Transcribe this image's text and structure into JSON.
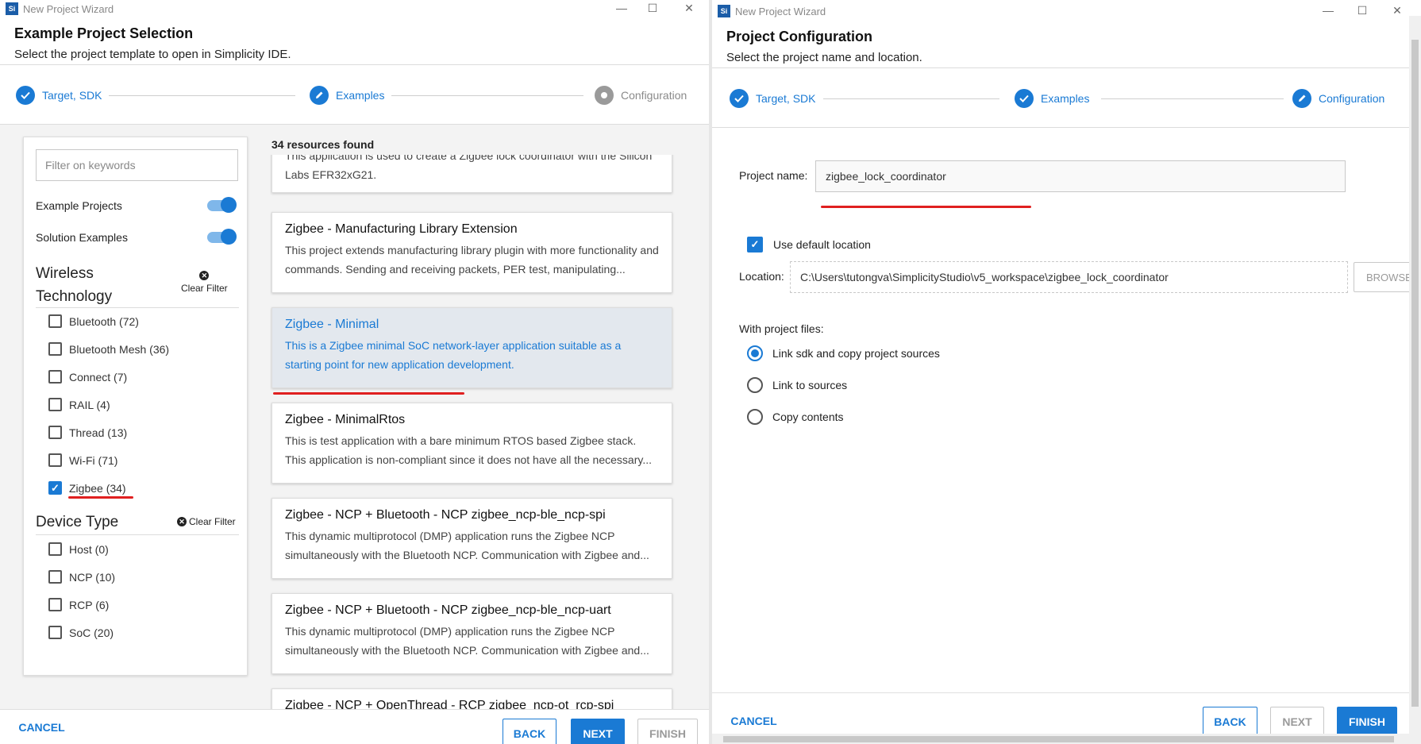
{
  "left_window": {
    "title": "New Project Wizard",
    "header_title": "Example Project Selection",
    "header_subtitle": "Select the project template to open in Simplicity IDE.",
    "steps": [
      {
        "label": "Target, SDK",
        "state": "done"
      },
      {
        "label": "Examples",
        "state": "active"
      },
      {
        "label": "Configuration",
        "state": "pending"
      }
    ],
    "filter": {
      "placeholder": "Filter on keywords",
      "toggles": [
        {
          "label": "Example Projects",
          "on": true
        },
        {
          "label": "Solution Examples",
          "on": true
        }
      ],
      "wireless_title_line1": "Wireless",
      "wireless_title_line2": "Technology",
      "clear_filter": "Clear Filter",
      "wireless_items": [
        {
          "label": "Bluetooth (72)",
          "checked": false
        },
        {
          "label": "Bluetooth Mesh (36)",
          "checked": false
        },
        {
          "label": "Connect (7)",
          "checked": false
        },
        {
          "label": "RAIL (4)",
          "checked": false
        },
        {
          "label": "Thread (13)",
          "checked": false
        },
        {
          "label": "Wi-Fi (71)",
          "checked": false
        },
        {
          "label": "Zigbee (34)",
          "checked": true
        }
      ],
      "device_title": "Device Type",
      "device_items": [
        {
          "label": "Host (0)",
          "checked": false
        },
        {
          "label": "NCP (10)",
          "checked": false
        },
        {
          "label": "RCP (6)",
          "checked": false
        },
        {
          "label": "SoC (20)",
          "checked": false
        }
      ]
    },
    "results_count": "34 resources found",
    "cards": [
      {
        "title": "",
        "desc": "This application is used to create a Zigbee lock coordinator with the Silicon Labs EFR32xG21."
      },
      {
        "title": "Zigbee - Manufacturing Library Extension",
        "desc": "This project extends manufacturing library plugin with more functionality and commands. Sending and receiving packets, PER test, manipulating..."
      },
      {
        "title": "Zigbee - Minimal",
        "desc": "This is a Zigbee minimal SoC network-layer application suitable as a starting point for new application development.",
        "selected": true
      },
      {
        "title": "Zigbee - MinimalRtos",
        "desc": "This is test application with a bare minimum RTOS based Zigbee stack. This application is non-compliant since it does not have all the necessary..."
      },
      {
        "title": "Zigbee - NCP + Bluetooth - NCP zigbee_ncp-ble_ncp-spi",
        "desc": "This dynamic multiprotocol (DMP) application runs the Zigbee NCP simultaneously with the Bluetooth NCP. Communication with Zigbee and..."
      },
      {
        "title": "Zigbee - NCP + Bluetooth - NCP zigbee_ncp-ble_ncp-uart",
        "desc": "This dynamic multiprotocol (DMP) application runs the Zigbee NCP simultaneously with the Bluetooth NCP. Communication with Zigbee and..."
      },
      {
        "title": "Zigbee - NCP + OpenThread - RCP zigbee_ncp-ot_rcp-spi",
        "desc": ""
      }
    ],
    "buttons": {
      "cancel": "CANCEL",
      "back": "BACK",
      "next": "NEXT",
      "finish": "FINISH"
    }
  },
  "right_window": {
    "title": "New Project Wizard",
    "header_title": "Project Configuration",
    "header_subtitle": "Select the project name and location.",
    "steps": [
      {
        "label": "Target, SDK",
        "state": "done"
      },
      {
        "label": "Examples",
        "state": "done"
      },
      {
        "label": "Configuration",
        "state": "active"
      }
    ],
    "project_name_label": "Project name:",
    "project_name_value": "zigbee_lock_coordinator",
    "use_default_location": "Use default location",
    "location_label": "Location:",
    "location_value": "C:\\Users\\tutongva\\SimplicityStudio\\v5_workspace\\zigbee_lock_coordinator",
    "browse": "BROWSE",
    "with_project_files": "With project files:",
    "radio_options": [
      {
        "label": "Link sdk and copy project sources",
        "selected": true
      },
      {
        "label": "Link to sources",
        "selected": false
      },
      {
        "label": "Copy contents",
        "selected": false
      }
    ],
    "buttons": {
      "cancel": "CANCEL",
      "back": "BACK",
      "next": "NEXT",
      "finish": "FINISH"
    }
  },
  "colors": {
    "accent": "#1a7ad4",
    "highlight": "#e02020",
    "selected_card": "#e3e8ee"
  },
  "icons": {
    "logo": "silicon-labs-logo",
    "check": "check-icon",
    "close": "close-icon"
  },
  "logo_text": "Si"
}
